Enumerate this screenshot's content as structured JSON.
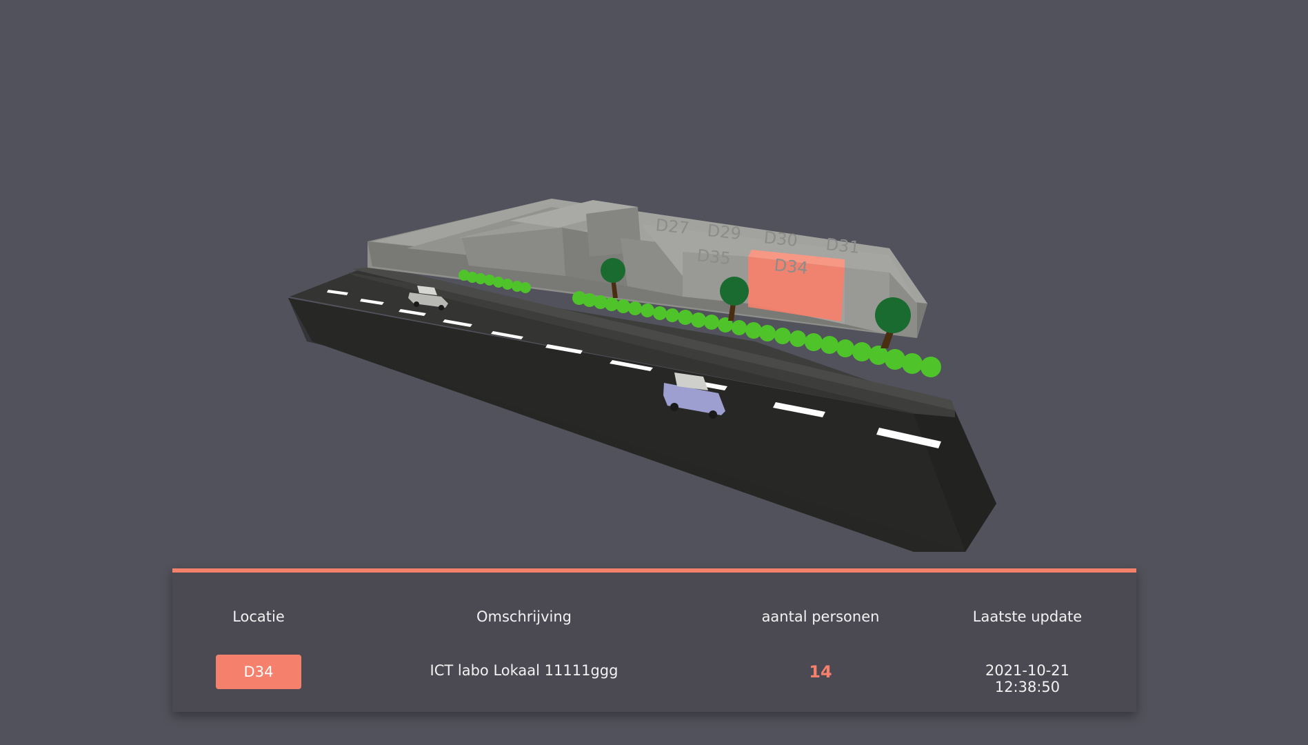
{
  "scene": {
    "rooms": [
      "D27",
      "D29",
      "D30",
      "D31",
      "D35",
      "D34"
    ],
    "highlighted_room": "D34",
    "accent_color": "#f5806c"
  },
  "table": {
    "headers": {
      "location": "Locatie",
      "description": "Omschrijving",
      "people": "aantal personen",
      "updated": "Laatste update"
    },
    "row": {
      "location": "D34",
      "description": "ICT labo Lokaal 11111ggg",
      "people": "14",
      "updated": "2021-10-21 12:38:50"
    }
  }
}
